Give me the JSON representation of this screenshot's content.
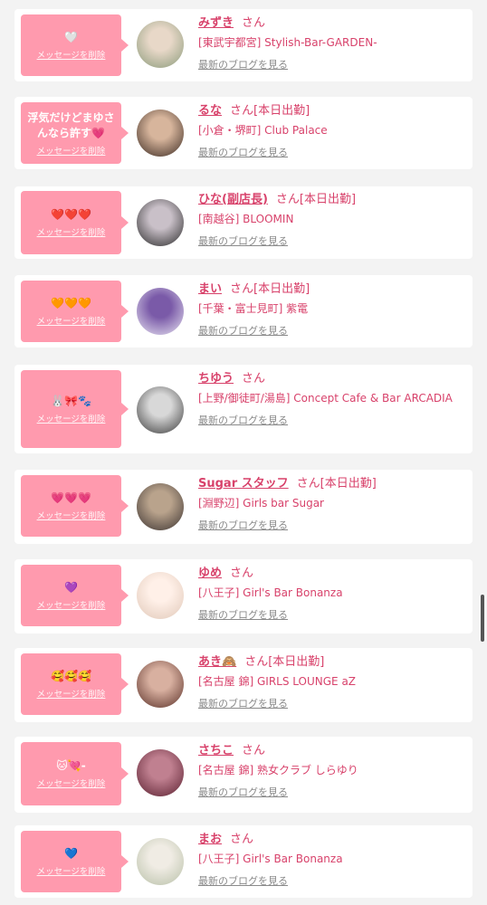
{
  "delete_label": "メッセージを削除",
  "blog_label": "最新のブログを見る",
  "san": "さん",
  "colors": {
    "bubble": "#ff9aae",
    "accent": "#d8426b"
  },
  "items": [
    {
      "message": "🤍",
      "name": "みずき",
      "status": "",
      "shop": "[東武宇都宮] Stylish-Bar-GARDEN-",
      "avatar": "photo"
    },
    {
      "message": "浮気だけどまゆさんなら許す💗",
      "name": "るな",
      "status": "[本日出勤]",
      "shop": "[小倉・堺町] Club Palace",
      "avatar": "photo"
    },
    {
      "message": "❤️❤️❤️",
      "name": "ひな(副店長)",
      "status": "[本日出勤]",
      "shop": "[南越谷] BLOOMIN",
      "avatar": "photo"
    },
    {
      "message": "🧡🧡🧡",
      "name": "まい",
      "status": "[本日出勤]",
      "shop": "[千葉・富士見町] 紫電",
      "avatar": "photo"
    },
    {
      "message": "🐰🎀🐾",
      "name": "ちゆう",
      "status": "",
      "shop": "[上野/御徒町/湯島] Concept Cafe & Bar ARCADIA",
      "avatar": "photo"
    },
    {
      "message": "💗💗💗",
      "name": "Sugar スタッフ",
      "status": "[本日出勤]",
      "shop": "[淵野辺] Girls bar Sugar",
      "avatar": "photo"
    },
    {
      "message": "💜",
      "name": "ゆめ",
      "status": "",
      "shop": "[八王子] Girl's Bar Bonanza",
      "avatar": "photo"
    },
    {
      "message": "🥰🥰🥰",
      "name": "あき🙈",
      "status": "[本日出勤]",
      "shop": "[名古屋 錦] GIRLS LOUNGE aZ",
      "avatar": "photo"
    },
    {
      "message": "🐱💘-",
      "name": "さちこ",
      "status": "",
      "shop": "[名古屋 錦] 熟女クラブ しらゆり",
      "avatar": "photo"
    },
    {
      "message": "💙",
      "name": "まお",
      "status": "",
      "shop": "[八王子] Girl's Bar Bonanza",
      "avatar": "photo"
    }
  ]
}
